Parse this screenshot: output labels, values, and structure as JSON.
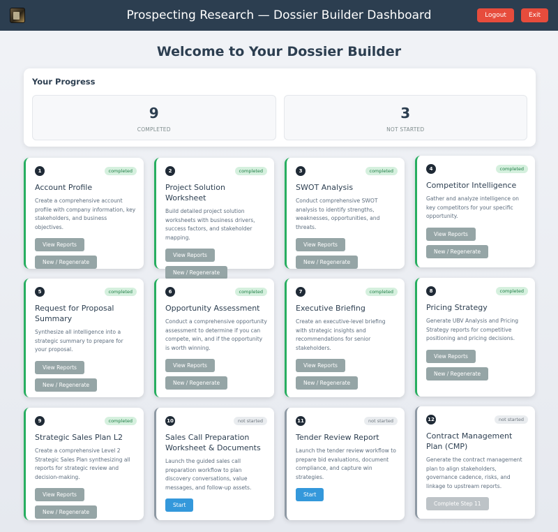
{
  "header": {
    "title": "Prospecting Research — Dossier Builder Dashboard",
    "logout_label": "Logout",
    "exit_label": "Exit"
  },
  "welcome": "Welcome to Your Dossier Builder",
  "progress": {
    "title": "Your Progress",
    "completed_count": "9",
    "completed_label": "COMPLETED",
    "not_started_count": "3",
    "not_started_label": "NOT STARTED"
  },
  "colors": {
    "header_bg": "#2c3e50",
    "danger": "#e74c3c",
    "completed_accent": "#27ae60",
    "pending_accent": "#8e99a4",
    "primary_button": "#3498db",
    "secondary_button": "#95a5a6"
  },
  "cards": [
    {
      "number": "1",
      "status": "completed",
      "title": "Account Profile",
      "desc": "Create a comprehensive account profile with company information, key stakeholders, and business objectives.",
      "btn1": "View Reports",
      "btn2": "New / Regenerate"
    },
    {
      "number": "2",
      "status": "completed",
      "title": "Project Solution Worksheet",
      "desc": "Build detailed project solution worksheets with business drivers, success factors, and stakeholder mapping.",
      "btn1": "View Reports",
      "btn2": "New / Regenerate"
    },
    {
      "number": "3",
      "status": "completed",
      "title": "SWOT Analysis",
      "desc": "Conduct comprehensive SWOT analysis to identify strengths, weaknesses, opportunities, and threats.",
      "btn1": "View Reports",
      "btn2": "New / Regenerate"
    },
    {
      "number": "4",
      "status": "completed",
      "title": "Competitor Intelligence",
      "desc": "Gather and analyze intelligence on key competitors for your specific opportunity.",
      "btn1": "View Reports",
      "btn2": "New / Regenerate"
    },
    {
      "number": "5",
      "status": "completed",
      "title": "Request for Proposal Summary",
      "desc": "Synthesize all intelligence into a strategic summary to prepare for your proposal.",
      "btn1": "View Reports",
      "btn2": "New / Regenerate"
    },
    {
      "number": "6",
      "status": "completed",
      "title": "Opportunity Assessment",
      "desc": "Conduct a comprehensive opportunity assessment to determine if you can compete, win, and if the opportunity is worth winning.",
      "btn1": "View Reports",
      "btn2": "New / Regenerate"
    },
    {
      "number": "7",
      "status": "completed",
      "title": "Executive Briefing",
      "desc": "Create an executive-level briefing with strategic insights and recommendations for senior stakeholders.",
      "btn1": "View Reports",
      "btn2": "New / Regenerate"
    },
    {
      "number": "8",
      "status": "completed",
      "title": "Pricing Strategy",
      "desc": "Generate UBV Analysis and Pricing Strategy reports for competitive positioning and pricing decisions.",
      "btn1": "View Reports",
      "btn2": "New / Regenerate"
    },
    {
      "number": "9",
      "status": "completed",
      "title": "Strategic Sales Plan L2",
      "desc": "Create a comprehensive Level 2 Strategic Sales Plan synthesizing all reports for strategic review and decision-making.",
      "btn1": "View Reports",
      "btn2": "New / Regenerate"
    },
    {
      "number": "10",
      "status": "not started",
      "title": "Sales Call Preparation Worksheet & Documents",
      "desc": "Launch the guided sales call preparation workflow to plan discovery conversations, value messages, and follow-up assets.",
      "btn1": "Start"
    },
    {
      "number": "11",
      "status": "not started",
      "title": "Tender Review Report",
      "desc": "Launch the tender review workflow to prepare bid evaluations, document compliance, and capture win strategies.",
      "btn1": "Start"
    },
    {
      "number": "12",
      "status": "not started",
      "title": "Contract Management Plan (CMP)",
      "desc": "Generate the contract management plan to align stakeholders, governance cadence, risks, and linkage to upstream reports.",
      "btn1": "Complete Step 11"
    }
  ]
}
